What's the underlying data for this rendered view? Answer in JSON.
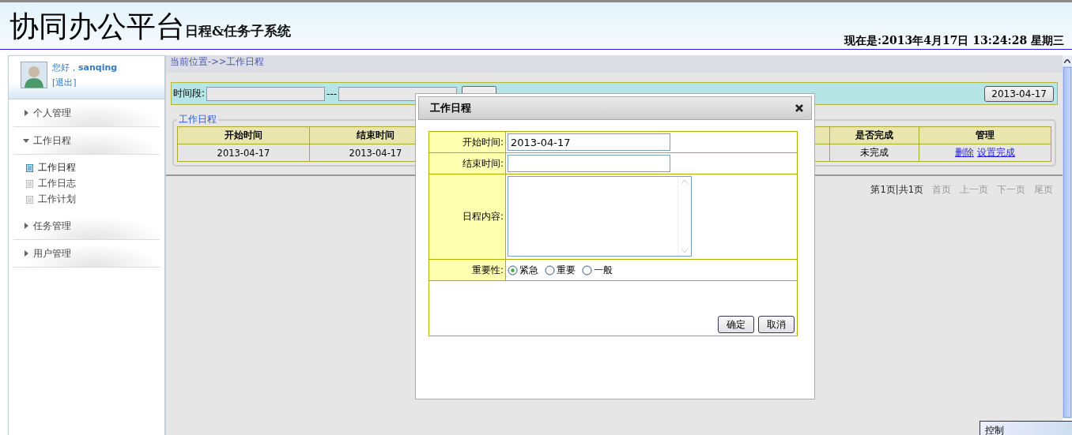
{
  "header": {
    "title": "协同办公平台",
    "subtitle": "日程&任务子系统",
    "datetime": "现在是:2013年4月17日 13:24:28 星期三"
  },
  "user": {
    "greeting": "您好，**sanqing**",
    "logout": "[退出]"
  },
  "sidebar": [
    {
      "label": "个人管理",
      "expanded": false
    },
    {
      "label": "工作日程",
      "expanded": true,
      "children": [
        {
          "label": "工作日程",
          "selected": true
        },
        {
          "label": "工作日志",
          "selected": false
        },
        {
          "label": "工作计划",
          "selected": false
        }
      ]
    },
    {
      "label": "任务管理",
      "expanded": false
    },
    {
      "label": "用户管理",
      "expanded": false
    }
  ],
  "breadcrumb": "当前位置->>工作日程",
  "filter": {
    "label": "时间段:",
    "separator": "---",
    "date_button": "2013-04-17"
  },
  "panel": {
    "legend": "工作日程",
    "columns": [
      "开始时间",
      "结束时间",
      "是否完成",
      "管理"
    ],
    "rows": [
      {
        "cells": [
          "2013-04-17",
          "2013-04-17",
          "未完成"
        ],
        "actions": [
          "删除",
          "设置完成"
        ]
      }
    ]
  },
  "pagination": {
    "info": "第1页|共1页",
    "links": [
      {
        "label": "首页",
        "disabled": true
      },
      {
        "label": "上一页",
        "disabled": true
      },
      {
        "label": "下一页",
        "disabled": true
      },
      {
        "label": "尾页",
        "disabled": true
      }
    ]
  },
  "dialog": {
    "title": "工作日程",
    "fields": [
      {
        "kind": "input",
        "label": "开始时间:",
        "value": "2013-04-17"
      },
      {
        "kind": "input",
        "label": "结束时间:"
      },
      {
        "kind": "textarea",
        "label": "日程内容:"
      },
      {
        "kind": "radio",
        "label": "重要性:",
        "options": [
          {
            "label": "紧急",
            "selected": true
          },
          {
            "label": "重要",
            "selected": false
          },
          {
            "label": "一般",
            "selected": false
          }
        ]
      }
    ],
    "buttons": [
      "确定",
      "取消"
    ]
  },
  "taskbar_popup": "控制"
}
